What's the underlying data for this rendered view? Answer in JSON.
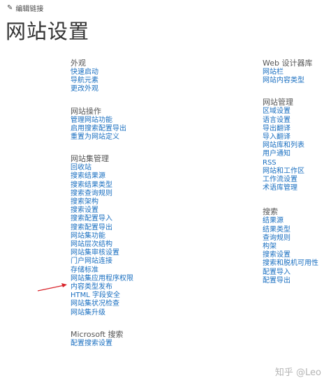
{
  "header": {
    "edit_link": "编辑链接",
    "title": "网站设置"
  },
  "left_sections": [
    {
      "title": "外观",
      "links": [
        "快速启动",
        "导航元素",
        "更改外观"
      ]
    },
    {
      "title": "网站操作",
      "links": [
        "管理网站功能",
        "启用搜索配置导出",
        "重置为网站定义"
      ]
    },
    {
      "title": "网站集管理",
      "links": [
        "回收站",
        "搜索结果源",
        "搜索结果类型",
        "搜索查询规则",
        "搜索架构",
        "搜索设置",
        "搜索配置导入",
        "搜索配置导出",
        "网站集功能",
        "网站层次结构",
        "网站集审核设置",
        "门户网站连接",
        "存储标准",
        "网站集应用程序权限",
        "内容类型发布",
        "HTML 字段安全",
        "网站集状况检查",
        "网站集升级"
      ]
    },
    {
      "title": "Microsoft 搜索",
      "links": [
        "配置搜索设置"
      ]
    }
  ],
  "right_sections": [
    {
      "title": "Web 设计器库",
      "links": [
        "网站栏",
        "网站内容类型"
      ]
    },
    {
      "title": "网站管理",
      "links": [
        "区域设置",
        "语言设置",
        "导出翻译",
        "导入翻译",
        "网站库和列表",
        "用户通知",
        "RSS",
        "网站和工作区",
        "工作流设置",
        "术语库管理"
      ]
    },
    {
      "title": "搜索",
      "links": [
        "结果源",
        "结果类型",
        "查询规则",
        "构架",
        "搜索设置",
        "搜索和脱机可用性",
        "配置导入",
        "配置导出"
      ]
    }
  ],
  "watermark": "知乎 @Leo",
  "colors": {
    "link": "#1a6fc0",
    "heading": "#555555",
    "title": "#333333",
    "arrow": "#d9232a"
  },
  "icons": {
    "edit": "pencil-icon",
    "annotation": "red-arrow-icon"
  }
}
